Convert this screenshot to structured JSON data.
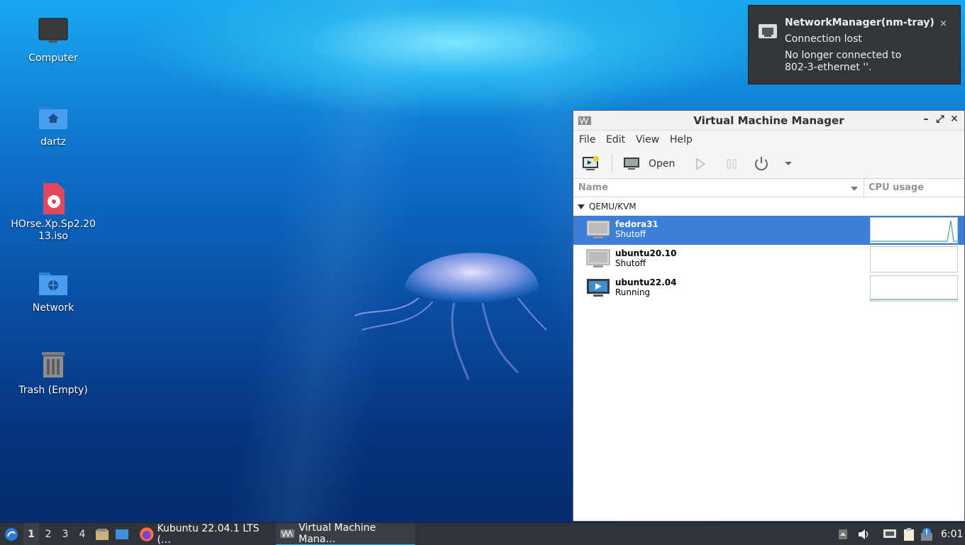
{
  "desktop": {
    "icons": [
      {
        "label": "Computer",
        "icon": "computer-icon"
      },
      {
        "label": "dartz",
        "icon": "home-folder-icon"
      },
      {
        "label": "HOrse.Xp.Sp2.2013.iso",
        "line1": "HOrse.Xp.Sp2.20",
        "line2": "13.iso",
        "icon": "disc-image-icon"
      },
      {
        "label": "Network",
        "icon": "network-folder-icon"
      },
      {
        "label": "Trash (Empty)",
        "icon": "trash-icon"
      }
    ]
  },
  "notification": {
    "app": "NetworkManager(nm-tray)",
    "summary": "Connection lost",
    "body": "No longer connected to 802-3-ethernet ''.",
    "close": "×",
    "icon": "ethernet-icon"
  },
  "vmm": {
    "title": "Virtual Machine Manager",
    "window_buttons": {
      "minimize": "–",
      "maximize": "⤢",
      "close": "✕"
    },
    "menu": [
      "File",
      "Edit",
      "View",
      "Help"
    ],
    "toolbar": {
      "new_vm_icon": "new-vm-icon",
      "open_label": "Open",
      "run_icon": "play-icon",
      "pause_icon": "pause-icon",
      "shutdown_icon": "power-icon",
      "more_icon": "dropdown-arrow-icon"
    },
    "columns": {
      "name": "Name",
      "cpu": "CPU usage"
    },
    "connection": "QEMU/KVM",
    "vms": [
      {
        "name": "fedora31",
        "status": "Shutoff",
        "selected": true
      },
      {
        "name": "ubuntu20.10",
        "status": "Shutoff",
        "selected": false
      },
      {
        "name": "ubuntu22.04",
        "status": "Running",
        "selected": false
      }
    ],
    "colors": {
      "selection": "#3b7fdb",
      "sparkline": "#5aa0a8"
    }
  },
  "taskbar": {
    "desktops": [
      "1",
      "2",
      "3",
      "4"
    ],
    "active_desktop": "1",
    "tasks": [
      {
        "label": "Kubuntu 22.04.1 LTS (…",
        "icon": "firefox-icon"
      },
      {
        "label": "Virtual Machine Mana…",
        "icon": "vmm-icon",
        "active": true
      }
    ],
    "clock": "6:01"
  }
}
